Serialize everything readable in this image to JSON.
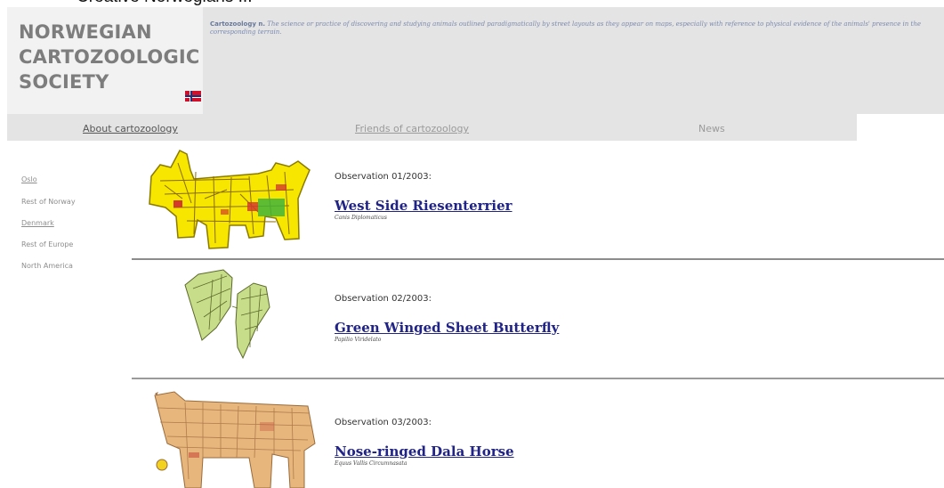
{
  "caption": "Creative Norwegians ...",
  "logo": {
    "line1": "NORWEGIAN",
    "line2": "CARTOZOOLOGIC",
    "line3": "SOCIETY"
  },
  "definition": {
    "term": "Cartozoology n.",
    "text": "The science or practice of discovering and studying animals outlined paradigmatically by street layouts as they appear on maps, especially with reference to physical evidence of the animals' presence in the corresponding terrain."
  },
  "nav": {
    "about": "About cartozoology",
    "friends": "Friends of cartozoology",
    "news": "News"
  },
  "sidebar": {
    "items": [
      {
        "label": "Oslo"
      },
      {
        "label": "Rest of Norway"
      },
      {
        "label": "Denmark"
      },
      {
        "label": "Rest of Europe"
      },
      {
        "label": "North America"
      }
    ]
  },
  "observations": [
    {
      "label": "Observation 01/2003:",
      "title": "West Side Riesenterrier",
      "latin": "Canis Diplomaticus"
    },
    {
      "label": "Observation 02/2003:",
      "title": "Green Winged Sheet Butterfly",
      "latin": "Papilio Viridelato"
    },
    {
      "label": "Observation 03/2003:",
      "title": "Nose-ringed Dala Horse",
      "latin": "Equus Vallis Circumnasata"
    }
  ]
}
